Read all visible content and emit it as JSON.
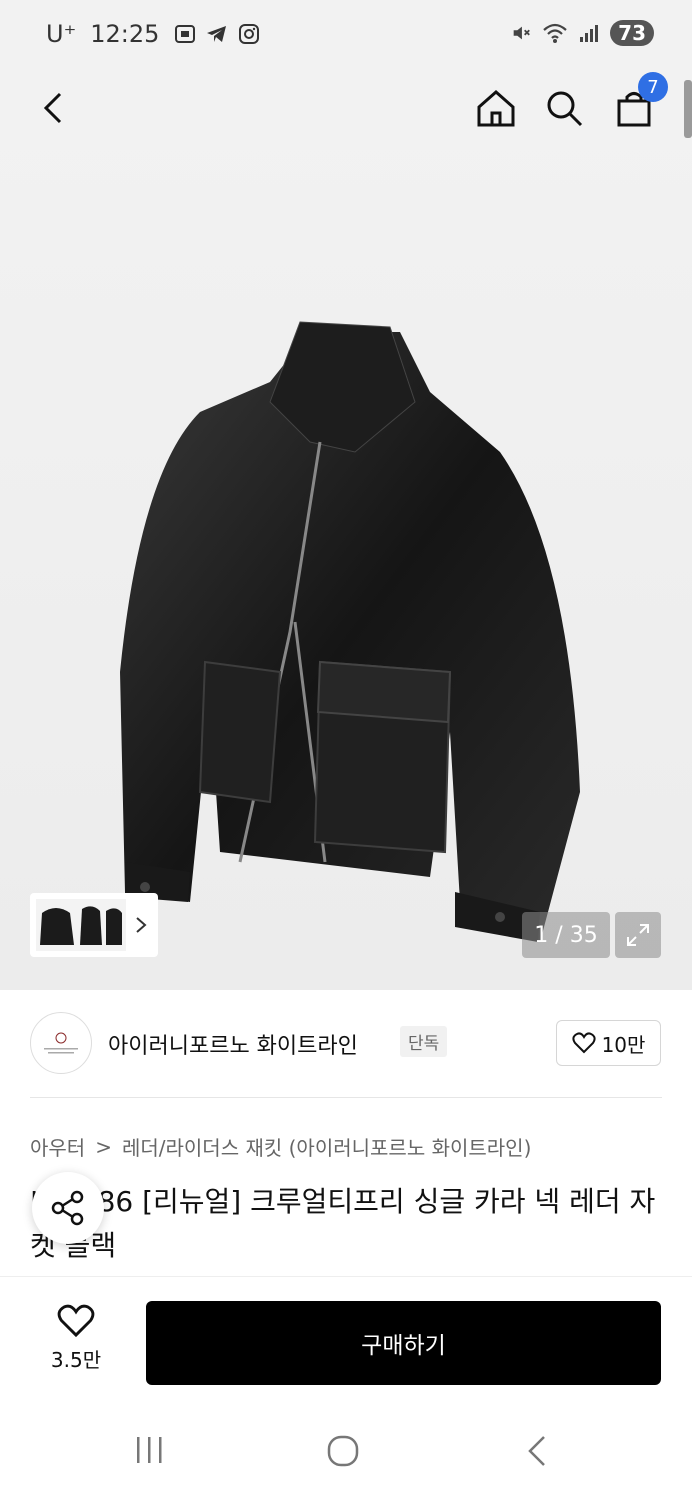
{
  "status": {
    "carrier": "U⁺",
    "time": "12:25",
    "battery": "73"
  },
  "nav": {
    "cart_count": "7"
  },
  "gallery": {
    "page_counter": "1 / 35"
  },
  "brand": {
    "name": "아이러니포르노 화이트라인",
    "badge": "단독",
    "likes": "10만"
  },
  "breadcrumb": {
    "category": "아우터",
    "separator": ">",
    "subcategory": "레더/라이더스 재킷 (아이러니포르노 화이트라인)"
  },
  "product": {
    "title": "IRO086 [리뉴얼] 크루얼티프리 싱글 카라 넥 레더 자켓 블랙"
  },
  "bottom": {
    "wish_count": "3.5만",
    "buy_label": "구매하기"
  },
  "colors": {
    "accent": "#2f6fe4",
    "buy_button": "#000000"
  }
}
